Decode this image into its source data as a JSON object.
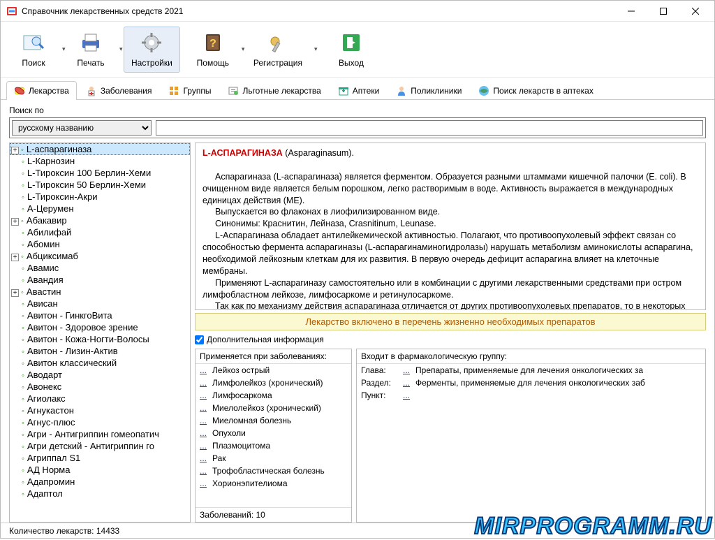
{
  "window_title": "Справочник лекарственных средств 2021",
  "toolbar": {
    "search": "Поиск",
    "print": "Печать",
    "settings": "Настройки",
    "help": "Помощь",
    "register": "Регистрация",
    "exit": "Выход"
  },
  "tabs": {
    "drugs": "Лекарства",
    "diseases": "Заболевания",
    "groups": "Группы",
    "privileged": "Льготные лекарства",
    "pharmacies": "Аптеки",
    "clinics": "Поликлиники",
    "pharmacy_search": "Поиск лекарств в аптеках"
  },
  "search": {
    "label": "Поиск по",
    "option": "русскому названию",
    "value": ""
  },
  "tree": [
    {
      "exp": "+",
      "name": "L-аспарагиназа",
      "sel": true
    },
    {
      "exp": "",
      "name": "L-Карнозин"
    },
    {
      "exp": "",
      "name": "L-Тироксин 100 Берлин-Хеми"
    },
    {
      "exp": "",
      "name": "L-Тироксин 50 Берлин-Хеми"
    },
    {
      "exp": "",
      "name": "L-Тироксин-Акри"
    },
    {
      "exp": "",
      "name": "А-Церумен"
    },
    {
      "exp": "+",
      "name": "Абакавир"
    },
    {
      "exp": "",
      "name": "Абилифай"
    },
    {
      "exp": "",
      "name": "Абомин"
    },
    {
      "exp": "+",
      "name": "Абциксимаб"
    },
    {
      "exp": "",
      "name": "Авамис"
    },
    {
      "exp": "",
      "name": "Авандия"
    },
    {
      "exp": "+",
      "name": "Авастин"
    },
    {
      "exp": "",
      "name": "Ависан"
    },
    {
      "exp": "",
      "name": "Авитон - ГинкгоВита"
    },
    {
      "exp": "",
      "name": "Авитон - Здоровое зрение"
    },
    {
      "exp": "",
      "name": "Авитон - Кожа-Ногти-Волосы"
    },
    {
      "exp": "",
      "name": "Авитон - Лизин-Актив"
    },
    {
      "exp": "",
      "name": "Авитон классический"
    },
    {
      "exp": "",
      "name": "Аводарт"
    },
    {
      "exp": "",
      "name": "Авонекс"
    },
    {
      "exp": "",
      "name": "Агиолакс"
    },
    {
      "exp": "",
      "name": "Агнукастон"
    },
    {
      "exp": "",
      "name": "Агнус-плюс"
    },
    {
      "exp": "",
      "name": "Агри - Антигриппин гомеопатич"
    },
    {
      "exp": "",
      "name": "Агри детский - Антигриппин го"
    },
    {
      "exp": "",
      "name": "Агриппал S1"
    },
    {
      "exp": "",
      "name": "АД Норма"
    },
    {
      "exp": "",
      "name": "Адапромин"
    },
    {
      "exp": "",
      "name": "Адаптол"
    }
  ],
  "description": {
    "title_ru": "L-АСПАРАГИНАЗА",
    "title_lat": " (Asparaginasum).",
    "p1": "Аспарагиназа (L-аспарагиназа) является ферментом. Образуется разными штаммами кишечной палочки (E. coli). В очищенном виде является белым порошком, легко растворимым в воде. Активность выражается в международных единицах действия (МЕ).",
    "p2": "Выпускается во флаконах в лиофилизированном виде.",
    "p3": "Синонимы: Краснитин, Лейназа, Crasnitinum, Leunase.",
    "p4": "L-Аспарагиназа обладает антилейкемической активностью. Полагают, что противоопухолевый эффект связан со способностью фермента аспарагиназы (L-аспарагинаминогидролазы) нарушать метаболизм аминокислоты аспарагина, необходимой лейкозным клеткам для их развития. В первую очередь дефицит аспарагина влияет на клеточные мембраны.",
    "p5": "Применяют L-аспарагиназу самостоятельно или в комбинации с другими лекарственными средствами при остром лимфобластном лейкозе, лимфосаркоме и ретинулосаркоме.",
    "p6": "Так как по механизму действия аспарагиназа отличается от других противоопухолевых препаратов, то в некоторых случаях она эффективна при безрезультатном применении других противоопухолевых"
  },
  "banner": "Лекарство включено в перечень жизненно необходимых препаратов",
  "extra_label": "Дополнительная информация",
  "diseases": {
    "heading": "Применяется при заболеваниях:",
    "items": [
      "Лейкоз острый",
      "Лимфолейкоз (хронический)",
      "Лимфосаркома",
      "Миелолейкоз (хронический)",
      "Миеломная болезнь",
      "Опухоли",
      "Плазмоцитома",
      "Рак",
      "Трофобластическая болезнь",
      "Хорионэпителиома"
    ],
    "count": "Заболеваний: 10"
  },
  "groups": {
    "heading": "Входит в фармакологическую группу:",
    "rows": {
      "chapter_label": "Глава:",
      "chapter_value": "Препараты, применяемые для лечения онкологических за",
      "section_label": "Раздел:",
      "section_value": "Ферменты, применяемые для лечения онкологических заб",
      "point_label": "Пункт:"
    }
  },
  "status": "Количество лекарств: 14433",
  "watermark": "MIRPROGRAMM.RU"
}
